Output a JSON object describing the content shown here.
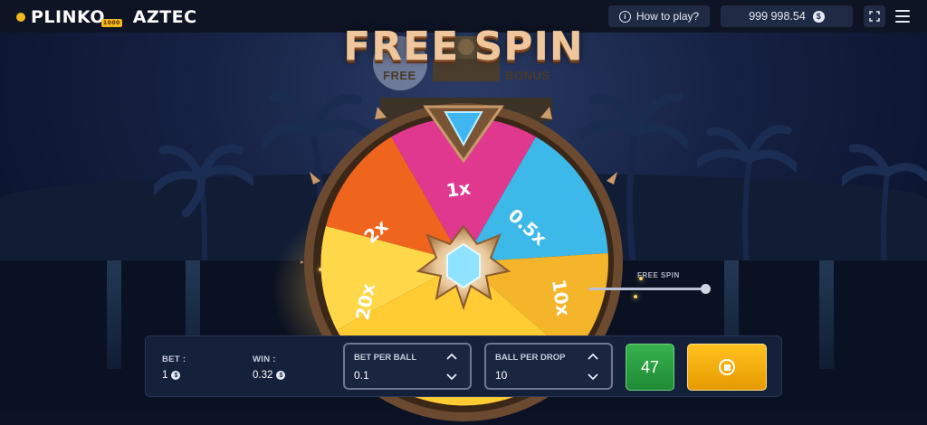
{
  "header": {
    "logo_text": "PLINKO",
    "logo_badge": "1000",
    "logo_text_2": "AZTEC",
    "how_to_play_label": "How to play?",
    "balance": "999 998.54",
    "currency_symbol": "$"
  },
  "game": {
    "title": "FREE SPIN",
    "totem_left_label": "FREE",
    "totem_right_label": "BONUS",
    "wheel_segments": [
      "1x",
      "0.5x",
      "10x",
      "20x",
      "2x"
    ],
    "free_spin_label": "FREE SPIN",
    "free_spin_progress": 1.0
  },
  "controls": {
    "bet_label": "BET :",
    "bet_value": "1",
    "win_label": "WIN :",
    "win_value": "0.32",
    "currency_symbol": "$",
    "bet_per_ball_label": "BET PER BALL",
    "bet_per_ball_value": "0.1",
    "ball_per_drop_label": "BALL PER DROP",
    "ball_per_drop_value": "10",
    "ball_count": "47"
  },
  "colors": {
    "accent_green": "#2ea043",
    "accent_gold": "#f5b400",
    "panel_bg": "#15203a"
  }
}
